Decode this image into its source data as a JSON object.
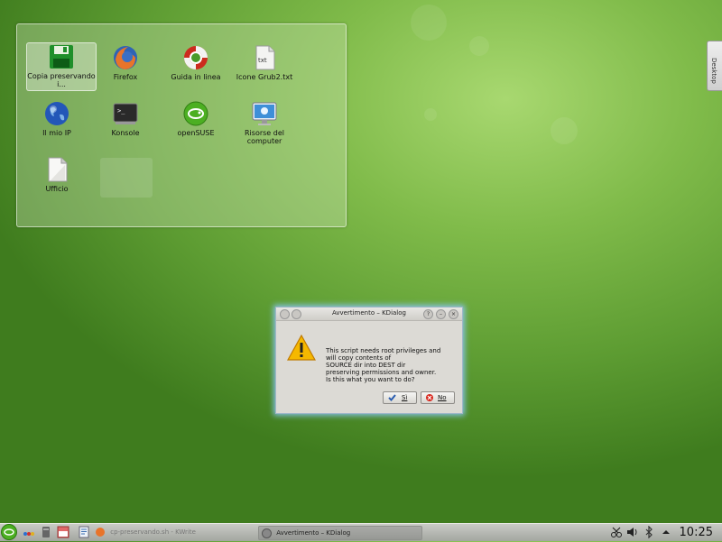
{
  "desktop_tab": {
    "label": "Desktop"
  },
  "folderview": {
    "icons": [
      {
        "label": "Copia preservando i...",
        "icon": "save-floppy-icon"
      },
      {
        "label": "Firefox",
        "icon": "firefox-icon"
      },
      {
        "label": "Guida in linea",
        "icon": "help-lifebuoy-icon"
      },
      {
        "label": "Icone Grub2.txt",
        "icon": "text-file-icon",
        "badge": "txt"
      },
      {
        "label": "Il mio IP",
        "icon": "globe-icon"
      },
      {
        "label": "Konsole",
        "icon": "terminal-icon",
        "glyph": ">_"
      },
      {
        "label": "openSUSE",
        "icon": "opensuse-icon"
      },
      {
        "label": "Risorse del computer",
        "icon": "computer-monitor-icon"
      },
      {
        "label": "Ufficio",
        "icon": "document-icon"
      }
    ]
  },
  "dialog": {
    "title": "Avvertimento – KDialog",
    "message_lines": [
      "This script needs root privileges and",
      "will copy contents of",
      "SOURCE dir into DEST dir",
      "preserving permissions and owner.",
      "Is this what you want to do?"
    ],
    "yes_label": "Sì",
    "no_label": "No",
    "help_btn": "?",
    "min_btn": "–",
    "close_btn": "×"
  },
  "taskbar": {
    "task1": "cp-preservando.sh - KWrite",
    "task2": "Avvertimento – KDialog",
    "clock": "10:25"
  },
  "colors": {
    "desktop_green": "#6aa83a",
    "dialog_bg": "#dcdad5",
    "warning_yellow": "#f5b800",
    "no_red": "#d8261c"
  }
}
